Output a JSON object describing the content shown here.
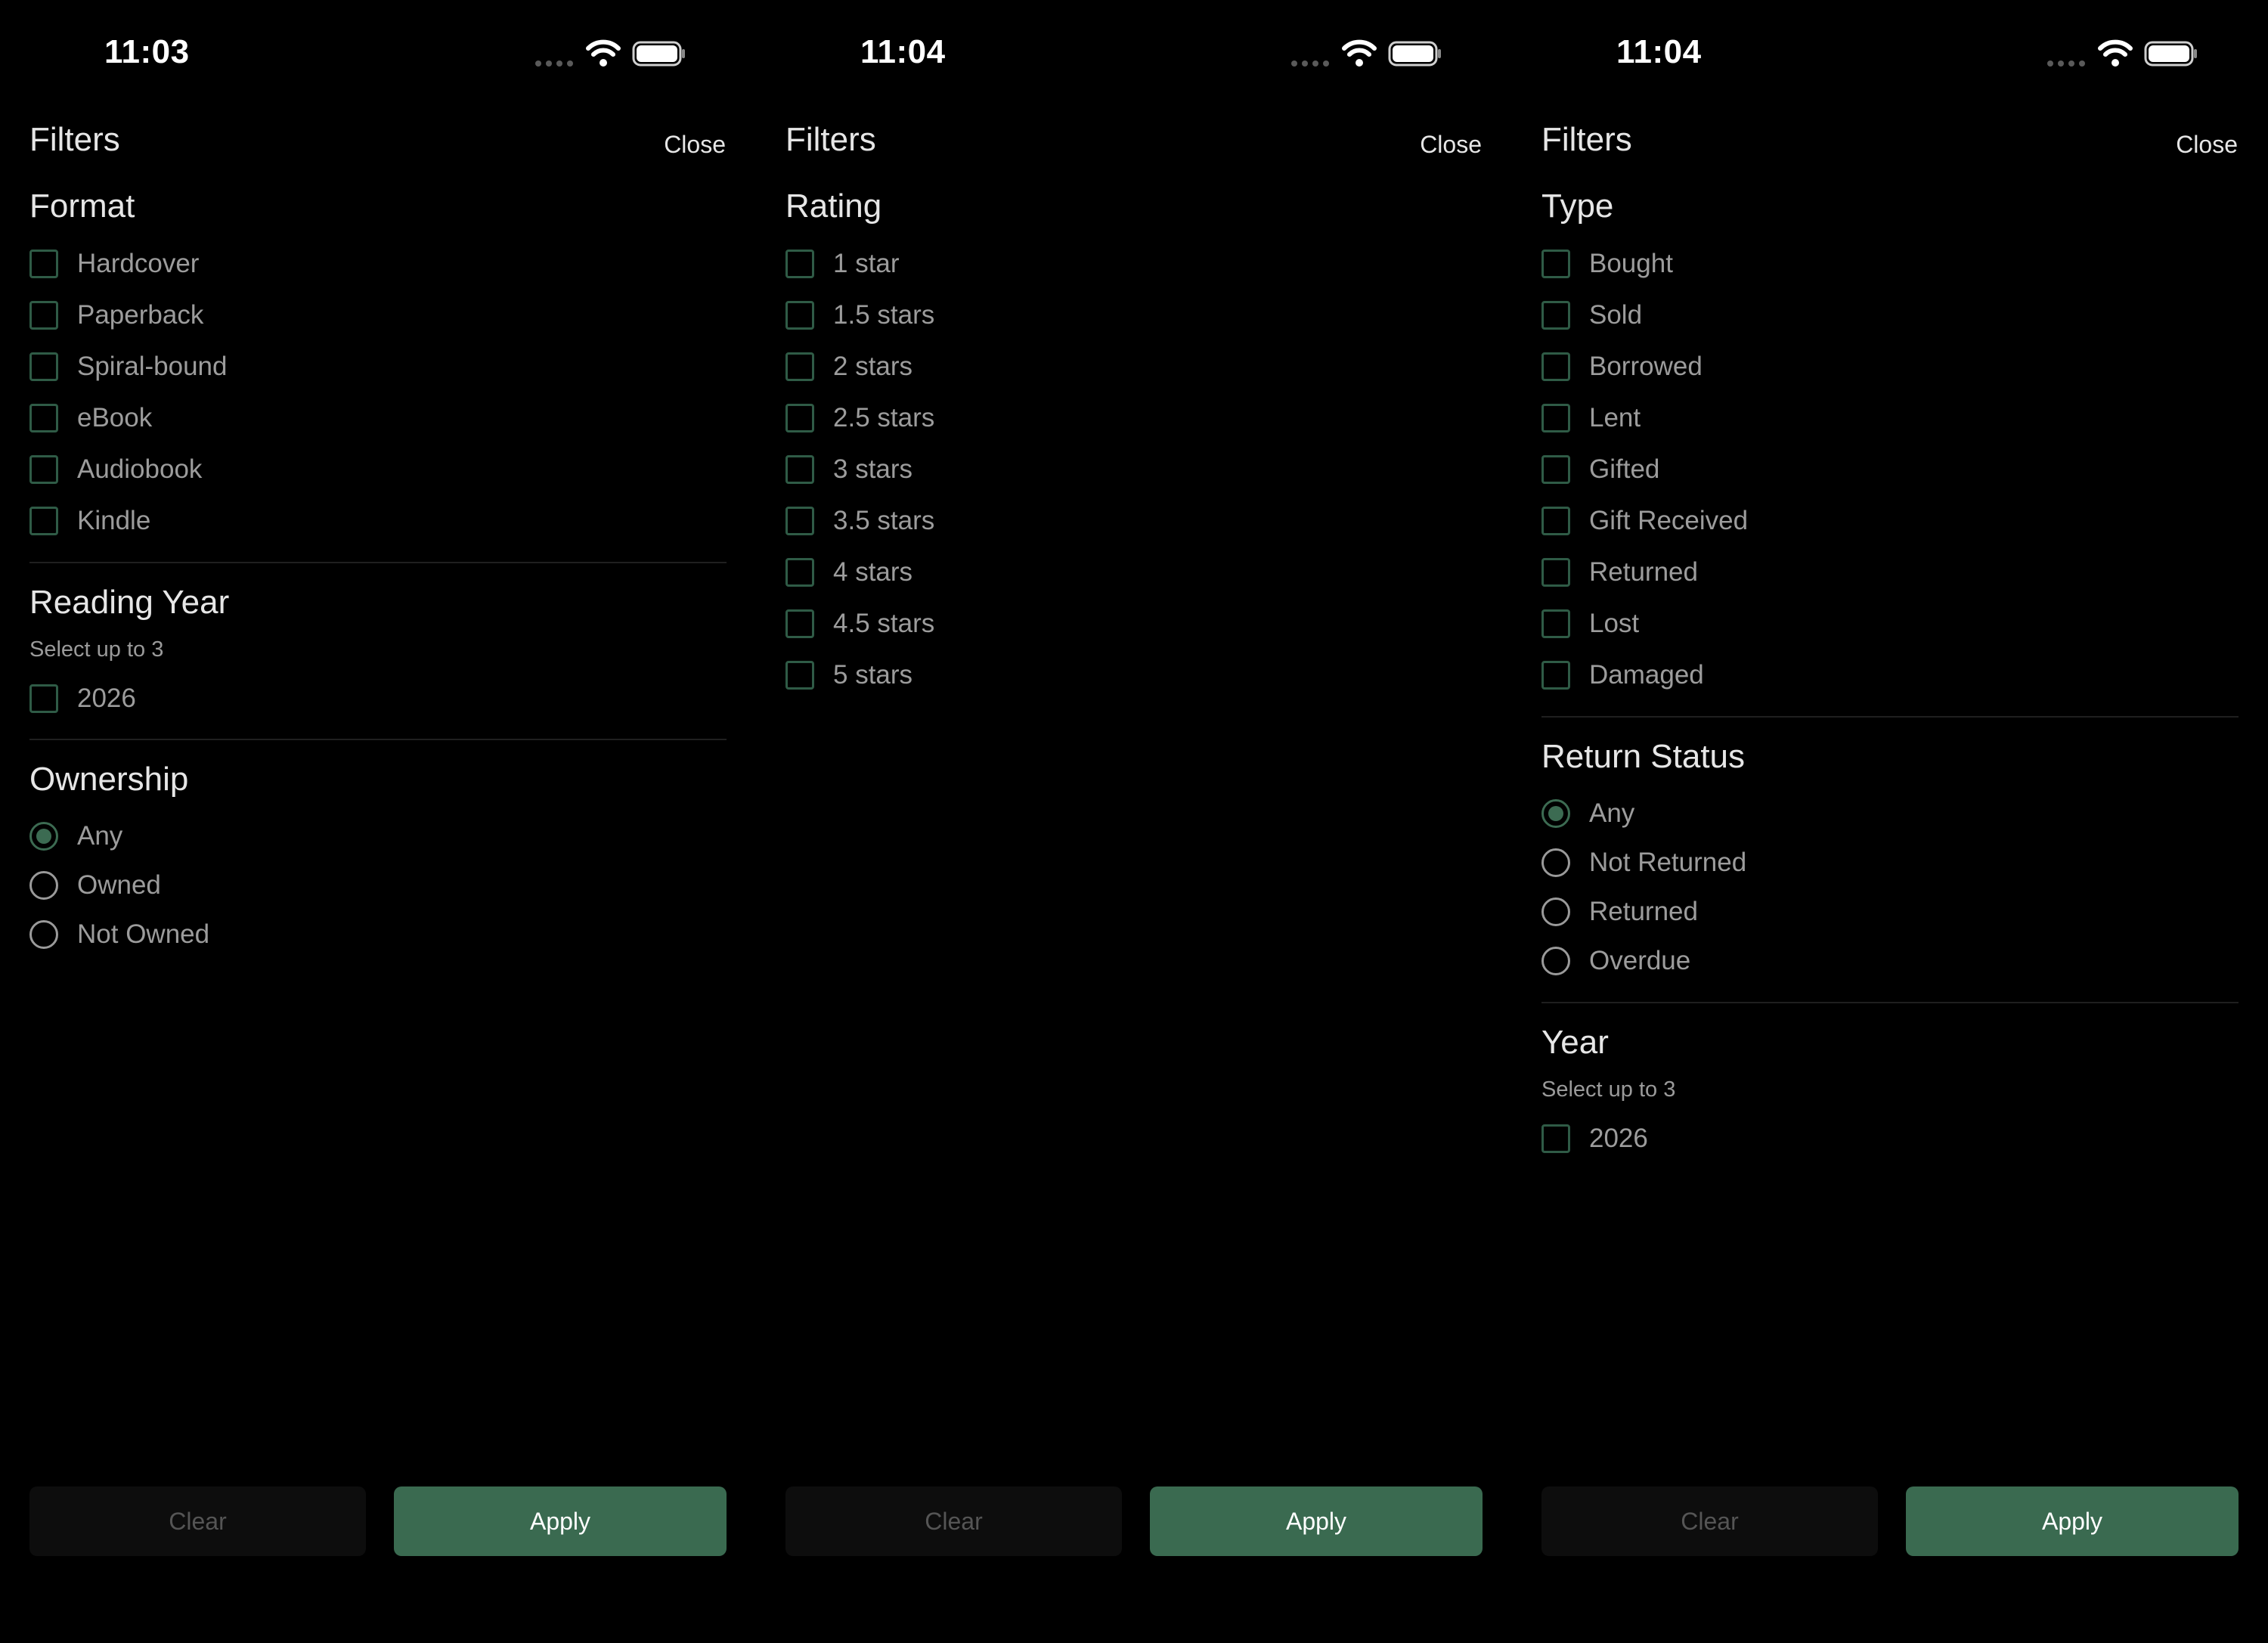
{
  "colors": {
    "background": "#000000",
    "accent": "#3a6a50",
    "checkbox_border": "#2f5b46",
    "clear_button_bg": "#0d0d0d"
  },
  "screens": [
    {
      "status": {
        "time": "11:03"
      },
      "header": {
        "title": "Filters",
        "close_label": "Close"
      },
      "sections": {
        "format": {
          "title": "Format",
          "options": [
            "Hardcover",
            "Paperback",
            "Spiral-bound",
            "eBook",
            "Audiobook",
            "Kindle"
          ]
        },
        "reading_year": {
          "title": "Reading Year",
          "hint": "Select up to 3",
          "options": [
            "2026"
          ]
        },
        "ownership": {
          "title": "Ownership",
          "options": [
            "Any",
            "Owned",
            "Not Owned"
          ],
          "selected": "Any"
        }
      },
      "footer": {
        "clear_label": "Clear",
        "apply_label": "Apply"
      }
    },
    {
      "status": {
        "time": "11:04"
      },
      "header": {
        "title": "Filters",
        "close_label": "Close"
      },
      "sections": {
        "rating": {
          "title": "Rating",
          "options": [
            "1 star",
            "1.5 stars",
            "2 stars",
            "2.5 stars",
            "3 stars",
            "3.5 stars",
            "4 stars",
            "4.5 stars",
            "5 stars"
          ]
        }
      },
      "footer": {
        "clear_label": "Clear",
        "apply_label": "Apply"
      }
    },
    {
      "status": {
        "time": "11:04"
      },
      "header": {
        "title": "Filters",
        "close_label": "Close"
      },
      "sections": {
        "type": {
          "title": "Type",
          "options": [
            "Bought",
            "Sold",
            "Borrowed",
            "Lent",
            "Gifted",
            "Gift Received",
            "Returned",
            "Lost",
            "Damaged"
          ]
        },
        "return_status": {
          "title": "Return Status",
          "options": [
            "Any",
            "Not Returned",
            "Returned",
            "Overdue"
          ],
          "selected": "Any"
        },
        "year": {
          "title": "Year",
          "hint": "Select up to 3",
          "options": [
            "2026"
          ]
        }
      },
      "footer": {
        "clear_label": "Clear",
        "apply_label": "Apply"
      }
    }
  ]
}
